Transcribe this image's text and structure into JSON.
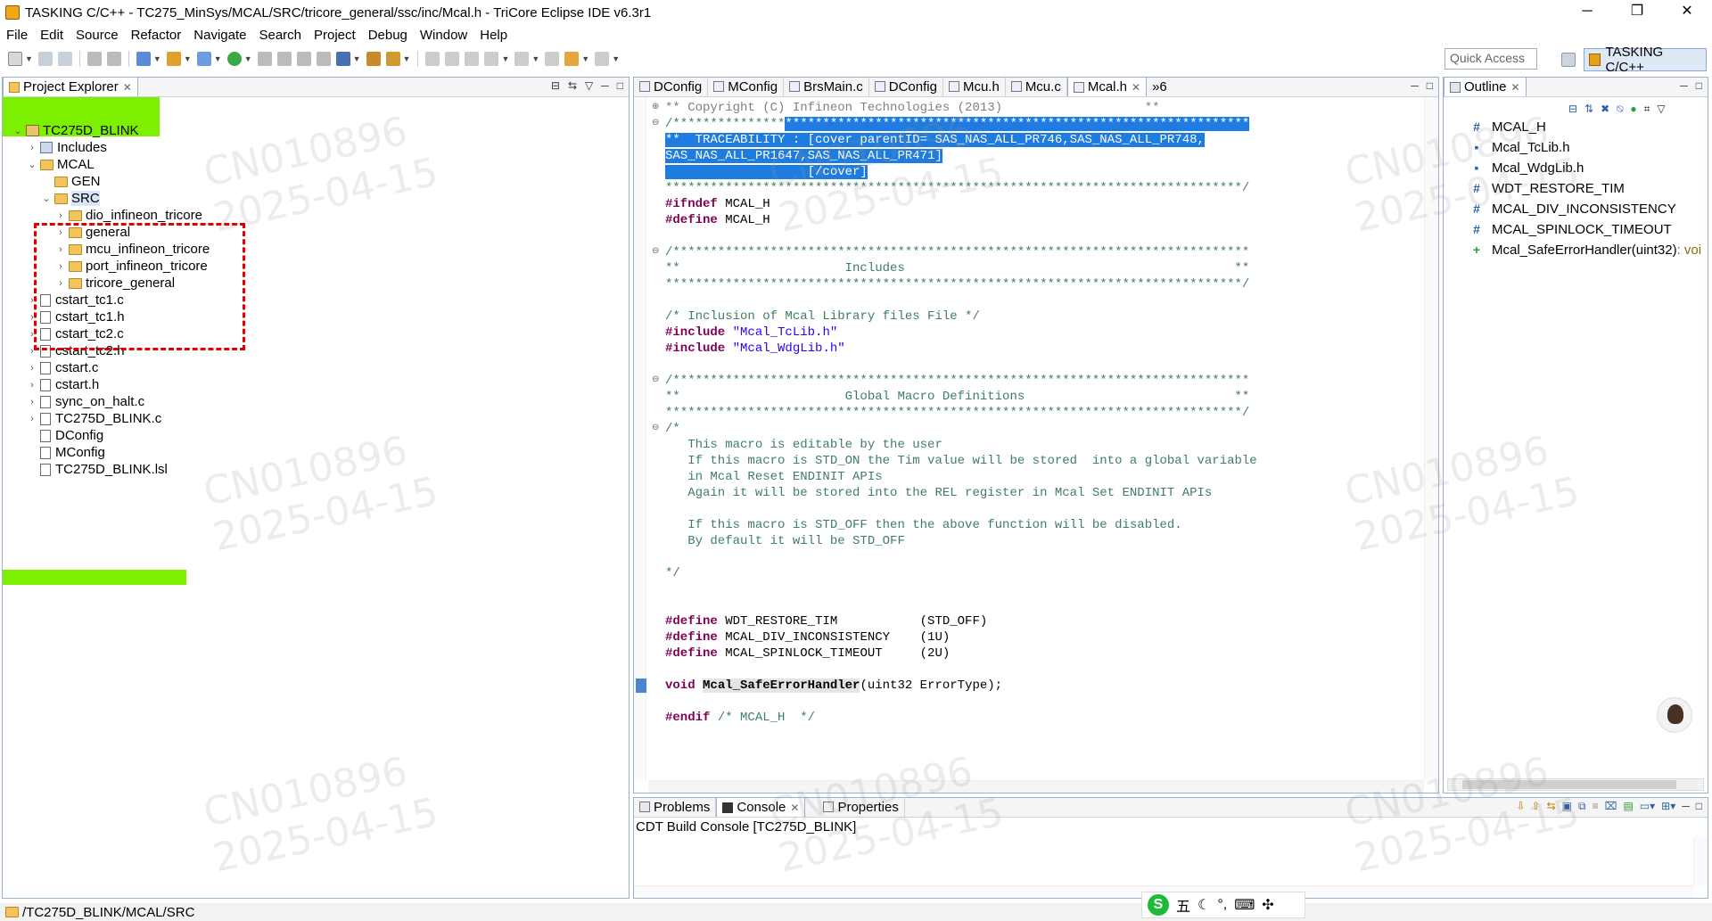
{
  "window": {
    "title": "TASKING C/C++ - TC275_MinSys/MCAL/SRC/tricore_general/ssc/inc/Mcal.h - TriCore Eclipse IDE v6.3r1",
    "minimize": "─",
    "restore": "❐",
    "close": "✕"
  },
  "menu": [
    "File",
    "Edit",
    "Source",
    "Refactor",
    "Navigate",
    "Search",
    "Project",
    "Debug",
    "Window",
    "Help"
  ],
  "toolbar": {
    "quick_access_placeholder": "Quick Access",
    "perspective": "TASKING C/C++"
  },
  "project_explorer": {
    "tab": "Project Explorer",
    "tree": [
      {
        "label": "TC275D_BLINK",
        "kind": "project",
        "expanded": true
      },
      {
        "label": "Includes",
        "kind": "includes",
        "expanded": false
      },
      {
        "label": "MCAL",
        "kind": "folder",
        "expanded": true
      },
      {
        "label": "GEN",
        "kind": "folder",
        "expanded": false
      },
      {
        "label": "SRC",
        "kind": "folder",
        "expanded": true
      },
      {
        "label": "dio_infineon_tricore",
        "kind": "folder",
        "expanded": false
      },
      {
        "label": "general",
        "kind": "folder",
        "expanded": false
      },
      {
        "label": "mcu_infineon_tricore",
        "kind": "folder",
        "expanded": false
      },
      {
        "label": "port_infineon_tricore",
        "kind": "folder",
        "expanded": false
      },
      {
        "label": "tricore_general",
        "kind": "folder",
        "expanded": false
      },
      {
        "label": "cstart_tc1.c",
        "kind": "file"
      },
      {
        "label": "cstart_tc1.h",
        "kind": "file"
      },
      {
        "label": "cstart_tc2.c",
        "kind": "file"
      },
      {
        "label": "cstart_tc2.h",
        "kind": "file"
      },
      {
        "label": "cstart.c",
        "kind": "file"
      },
      {
        "label": "cstart.h",
        "kind": "file"
      },
      {
        "label": "sync_on_halt.c",
        "kind": "file"
      },
      {
        "label": "TC275D_BLINK.c",
        "kind": "file"
      },
      {
        "label": "DConfig",
        "kind": "file"
      },
      {
        "label": "MConfig",
        "kind": "file"
      },
      {
        "label": "TC275D_BLINK.lsl",
        "kind": "file"
      }
    ]
  },
  "editor": {
    "tabs": [
      "DConfig",
      "MConfig",
      "BrsMain.c",
      "DConfig",
      "Mcu.h",
      "Mcu.c",
      "Mcal.h"
    ],
    "overflow": "»6",
    "active_tab": "Mcal.h",
    "lines": [
      "** Copyright (C) Infineon Technologies (2013)                   **",
      "/*****************************************************************************",
      "**  TRACEABILITY : [cover parentID= SAS_NAS_ALL_PR746,SAS_NAS_ALL_PR748,",
      "SAS_NAS_ALL_PR1647,SAS_NAS_ALL_PR471]",
      "                   [/cover]",
      "*****************************************************************************/",
      "#ifndef MCAL_H",
      "#define MCAL_H",
      "",
      "/*****************************************************************************",
      "**                      Includes                                            **",
      "*****************************************************************************/",
      "",
      "/* Inclusion of Mcal Library files File */",
      "#include \"Mcal_TcLib.h\"",
      "#include \"Mcal_WdgLib.h\"",
      "",
      "/*****************************************************************************",
      "**                      Global Macro Definitions                            **",
      "*****************************************************************************/",
      "/*",
      "   This macro is editable by the user",
      "   If this macro is STD_ON the Tim value will be stored  into a global variable",
      "   in Mcal Reset ENDINIT APIs",
      "   Again it will be stored into the REL register in Mcal Set ENDINIT APIs",
      "",
      "   If this macro is STD_OFF then the above function will be disabled.",
      "   By default it will be STD_OFF",
      "",
      "*/",
      "",
      "",
      "#define WDT_RESTORE_TIM           (STD_OFF)",
      "#define MCAL_DIV_INCONSISTENCY    (1U)",
      "#define MCAL_SPINLOCK_TIMEOUT     (2U)",
      "",
      "void Mcal_SafeErrorHandler(uint32 ErrorType);",
      "",
      "#endif /* MCAL_H  */"
    ]
  },
  "outline": {
    "tab": "Outline",
    "items": [
      {
        "icon": "#",
        "label": "MCAL_H"
      },
      {
        "icon": "▪",
        "label": "Mcal_TcLib.h"
      },
      {
        "icon": "▪",
        "label": "Mcal_WdgLib.h"
      },
      {
        "icon": "#",
        "label": "WDT_RESTORE_TIM"
      },
      {
        "icon": "#",
        "label": "MCAL_DIV_INCONSISTENCY"
      },
      {
        "icon": "#",
        "label": "MCAL_SPINLOCK_TIMEOUT"
      },
      {
        "icon": "+",
        "label": "Mcal_SafeErrorHandler(uint32)",
        "suffix": " : voi"
      }
    ]
  },
  "bottom_panel": {
    "tabs": [
      "Problems",
      "Console",
      "Properties"
    ],
    "active_tab": "Console",
    "console_title": "CDT Build Console [TC275D_BLINK]"
  },
  "status_bar": {
    "path": "/TC275D_BLINK/MCAL/SRC"
  },
  "ime": {
    "logo": "S",
    "glyphs": [
      "五",
      "☾",
      "°,",
      "⌨",
      "✣"
    ]
  },
  "watermark": {
    "id": "CN010896",
    "date": "2025-04-15"
  }
}
